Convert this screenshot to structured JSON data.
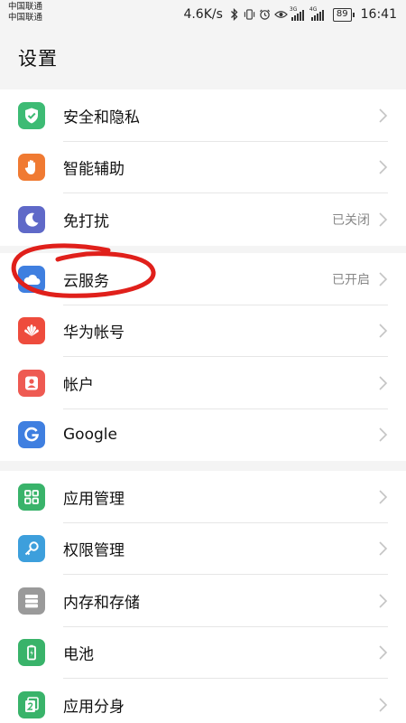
{
  "status_bar": {
    "carrier_1": "中国联通",
    "carrier_2": "中国联通",
    "net_speed": "4.6K/s",
    "sig1_tag": "3G",
    "sig2_tag": "4G",
    "battery": "89",
    "time": "16:41"
  },
  "header": {
    "title": "设置"
  },
  "groups": [
    {
      "items": [
        {
          "label": "安全和隐私",
          "value": "",
          "icon": "shield-check-icon",
          "color": "#3dbb74"
        },
        {
          "label": "智能辅助",
          "value": "",
          "icon": "hand-icon",
          "color": "#f07a32"
        },
        {
          "label": "免打扰",
          "value": "已关闭",
          "icon": "moon-icon",
          "color": "#5f69c8"
        }
      ]
    },
    {
      "items": [
        {
          "label": "云服务",
          "value": "已开启",
          "icon": "cloud-icon",
          "color": "#3f7fe0"
        },
        {
          "label": "华为帐号",
          "value": "",
          "icon": "huawei-logo-icon",
          "color": "#ee4c3d"
        },
        {
          "label": "帐户",
          "value": "",
          "icon": "person-icon",
          "color": "#ee5a52"
        },
        {
          "label": "Google",
          "value": "",
          "icon": "google-g-icon",
          "color": "#3f7fe0"
        }
      ]
    },
    {
      "items": [
        {
          "label": "应用管理",
          "value": "",
          "icon": "apps-grid-icon",
          "color": "#39b36a"
        },
        {
          "label": "权限管理",
          "value": "",
          "icon": "key-icon",
          "color": "#3d9fdc"
        },
        {
          "label": "内存和存储",
          "value": "",
          "icon": "storage-icon",
          "color": "#9a9a9a"
        },
        {
          "label": "电池",
          "value": "",
          "icon": "battery-icon",
          "color": "#39b36a"
        },
        {
          "label": "应用分身",
          "value": "",
          "icon": "app-twin-icon",
          "color": "#39b36a"
        }
      ]
    }
  ],
  "annotation": {
    "color": "#e0201b"
  }
}
